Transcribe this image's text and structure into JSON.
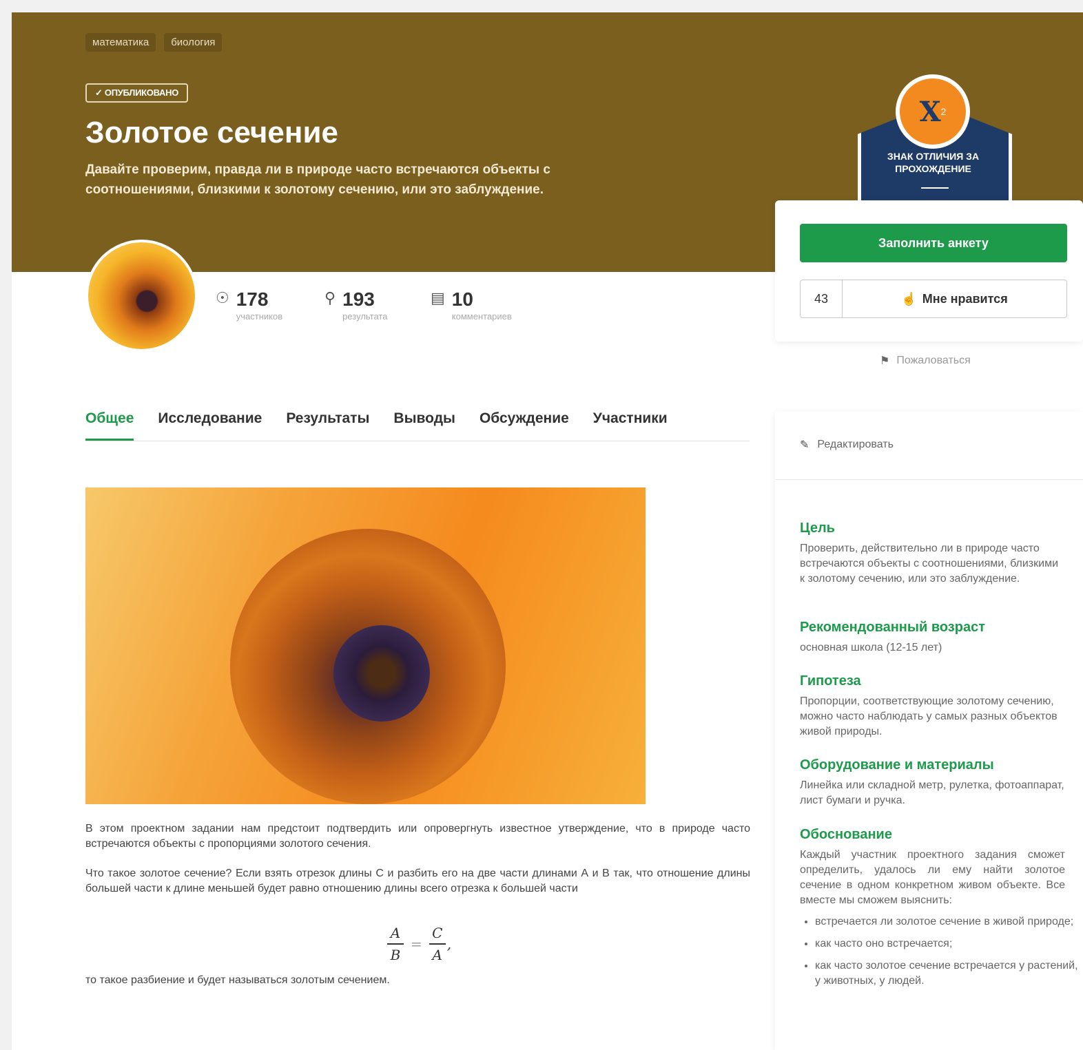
{
  "hero": {
    "tags": [
      "математика",
      "биология"
    ],
    "status": "✓ ОПУБЛИКОВАНО",
    "title": "Золотое сечение",
    "subtitle": "Давайте проверим, правда ли в природе часто встречаются объекты с соотношениями, близкими к золотому сечению, или это заблуждение."
  },
  "badge": {
    "icon": "x-squared-ruler-icon",
    "symbol": "X",
    "sup": "2",
    "text": "ЗНАК ОТЛИЧИЯ ЗА ПРОХОЖДЕНИЕ",
    "color": "#1e3a66",
    "accent": "#f28a20"
  },
  "actions": {
    "fill_label": "Заполнить анкету",
    "like_count": "43",
    "like_label": "Мне нравится",
    "report_label": "Пожаловаться"
  },
  "stats": [
    {
      "icon": "person-icon",
      "value": "178",
      "label": "участников"
    },
    {
      "icon": "lightbulb-icon",
      "value": "193",
      "label": "результата"
    },
    {
      "icon": "comment-icon",
      "value": "10",
      "label": "комментариев"
    }
  ],
  "tabs": [
    "Общее",
    "Исследование",
    "Результаты",
    "Выводы",
    "Обсуждение",
    "Участники"
  ],
  "content": {
    "p1": "В этом проектном задании нам предстоит подтвердить или опровергнуть известное утверждение, что в природе часто встречаются объекты с пропорциями золотого сечения.",
    "p2": "Что такое золотое сечение? Если взять отрезок длины С и разбить его на две части длинами А и В так, что отношение длины большей части к длине меньшей будет равно отношению длины всего отрезка к большей части",
    "formula": {
      "num1": "A",
      "den1": "B",
      "eq": "=",
      "num2": "C",
      "den2": "A",
      "tail": ","
    },
    "p3": "то такое разбиение и будет называться золотым сечением."
  },
  "sidebar": {
    "edit_label": "Редактировать",
    "sections": [
      {
        "title": "Цель",
        "text": "Проверить, действительно ли в природе часто встречаются объекты с соотношениями, близкими к золотому сечению, или это заблуждение."
      },
      {
        "title": "Рекомендованный возраст",
        "text": "основная школа (12-15 лет)"
      },
      {
        "title": "Гипотеза",
        "text": "Пропорции, соответствующие золотому сечению, можно часто наблюдать у самых разных объектов живой природы."
      },
      {
        "title": "Оборудование и материалы",
        "text": "Линейка или складной метр, рулетка, фотоаппарат, лист бумаги и ручка."
      },
      {
        "title": "Обоснование",
        "text": "Каждый участник проектного задания сможет определить, удалось ли ему найти золотое сечение в одном конкретном живом объекте. Все вместе мы сможем выяснить:"
      }
    ],
    "bullets": [
      "встречается ли золотое сечение в живой природе;",
      "как часто оно встречается;",
      "как часто золотое сечение встречается у растений, у животных, у людей."
    ]
  },
  "colors": {
    "hero_bg": "#7a5f1f",
    "accent_green": "#1d9a4a"
  }
}
